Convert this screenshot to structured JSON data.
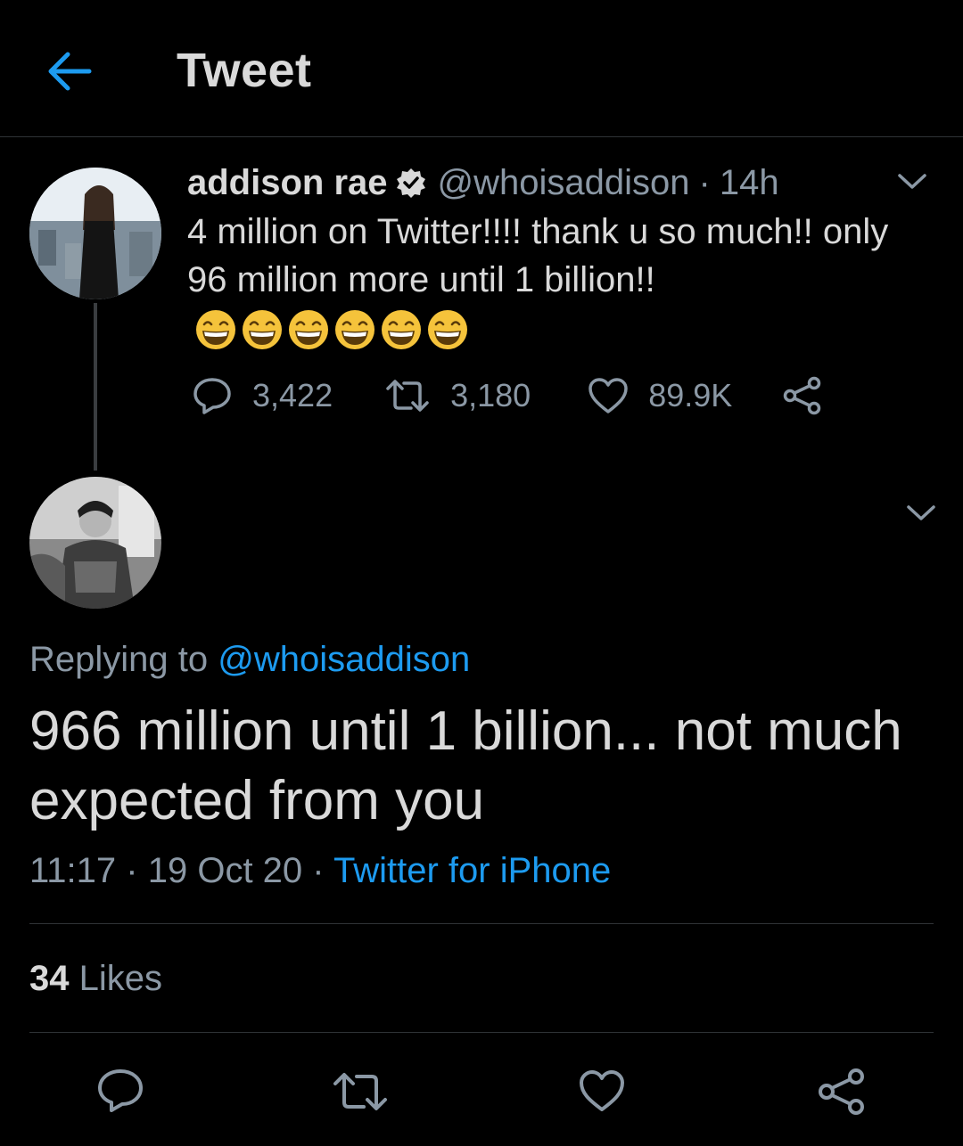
{
  "header": {
    "title": "Tweet",
    "back_icon": "arrow-left-icon"
  },
  "colors": {
    "background": "#000000",
    "accent": "#1d9bf0",
    "muted": "#8b98a5",
    "text": "#d9d9d9"
  },
  "parent_tweet": {
    "name": "addison rae",
    "handle": "@whoisaddison",
    "separator": "·",
    "time": "14h",
    "text": "4 million on Twitter!!!! thank u so much!! only 96 million more until 1 billion!!",
    "emoji": "😄",
    "emoji_count": 6,
    "replies": "3,422",
    "retweets": "3,180",
    "likes": "89.9K"
  },
  "reply_tweet": {
    "replying_prefix": "Replying to",
    "replying_handle": "@whoisaddison",
    "text": "966 million until 1 billion... not much expected from you",
    "time": "11:17",
    "sep1": "·",
    "date": "19 Oct 20",
    "sep2": "·",
    "source": "Twitter for iPhone",
    "likes_count": "34",
    "likes_label": "Likes"
  }
}
